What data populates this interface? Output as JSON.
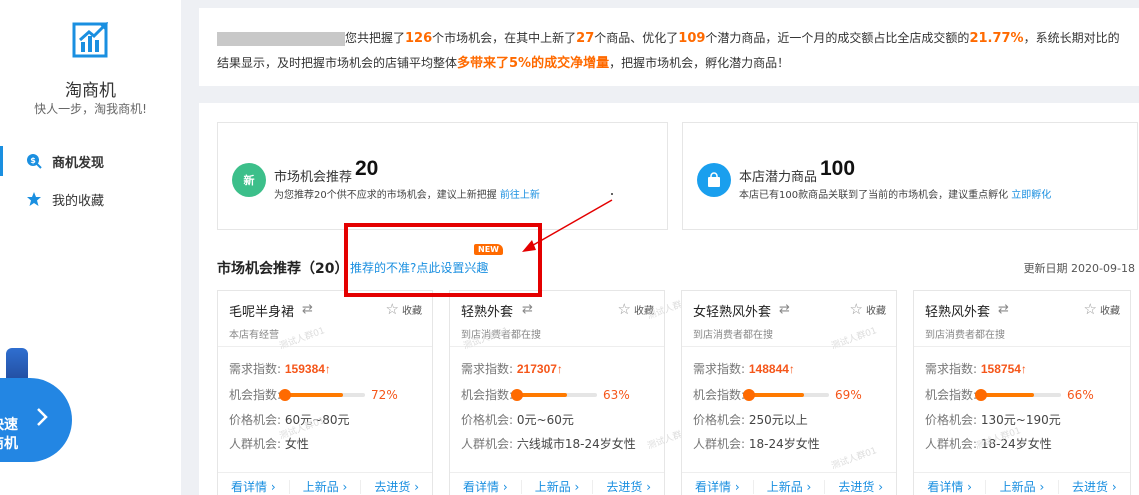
{
  "sidebar": {
    "app_name": "淘商机",
    "slogan": "快人一步，淘我商机!",
    "items": [
      {
        "label": "商机发现",
        "icon": "coin-search-icon",
        "active": true
      },
      {
        "label": "我的收藏",
        "icon": "star-icon",
        "active": false
      }
    ],
    "promo": {
      "line1": "快速",
      "line2": "商机"
    }
  },
  "summary": {
    "p1": "您共把握了",
    "n1": "126",
    "p2": "个市场机会，在其中上新了",
    "n2": "27",
    "p3": "个商品、优化了",
    "n3": "109",
    "p4": "个潜力商品，近一个月的成交额占比全店成交额的",
    "n4": "21.77%",
    "p5": "，系统长期对比的结果显示，及时把握市场机会的店铺平均整体",
    "n5": "多带来了5%的成交净增量",
    "p6": "，把握市场机会，孵化潜力商品！"
  },
  "stats": [
    {
      "icon_text": "新",
      "title": "市场机会推荐",
      "num": "20",
      "desc": "为您推荐20个供不应求的市场机会，建议上新把握",
      "link": "前往上新"
    },
    {
      "title": "本店潜力商品",
      "num": "100",
      "desc": "本店已有100款商品关联到了当前的市场机会，建议重点孵化",
      "link": "立即孵化"
    }
  ],
  "section": {
    "title": "市场机会推荐（20）",
    "link": "推荐的不准?点此设置兴趣",
    "badge": "NEW",
    "update_date": "更新日期 2020-09-18"
  },
  "labels": {
    "demand": "需求指数:",
    "opportunity": "机会指数:",
    "price": "价格机会:",
    "crowd": "人群机会:",
    "fav": "收藏",
    "details": "看详情",
    "new_product": "上新品",
    "restock": "去进货",
    "watermark": "测试人群01"
  },
  "cards": [
    {
      "name": "毛呢半身裙",
      "sub": "本店有经营",
      "demand": "159384",
      "opportunity_pct": "72%",
      "opportunity": 0.72,
      "price": "60元~80元",
      "crowd": "女性"
    },
    {
      "name": "轻熟外套",
      "sub": "到店消费者都在搜",
      "demand": "217307",
      "opportunity_pct": "63%",
      "opportunity": 0.63,
      "price": "0元~60元",
      "crowd": "六线城市18-24岁女性"
    },
    {
      "name": "女轻熟风外套",
      "sub": "到店消费者都在搜",
      "demand": "148844",
      "opportunity_pct": "69%",
      "opportunity": 0.69,
      "price": "250元以上",
      "crowd": "18-24岁女性"
    },
    {
      "name": "轻熟风外套",
      "sub": "到店消费者都在搜",
      "demand": "158754",
      "opportunity_pct": "66%",
      "opportunity": 0.66,
      "price": "130元~190元",
      "crowd": "18-24岁女性"
    }
  ],
  "colors": {
    "accent": "#1a8fe0",
    "orange": "#ff6a00",
    "annotation": "#e40000"
  }
}
